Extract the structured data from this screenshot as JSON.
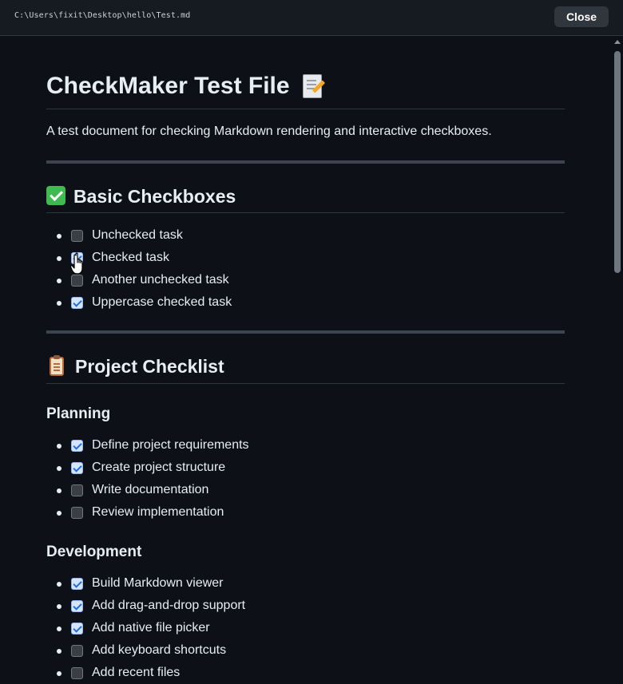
{
  "window": {
    "file_path": "C:\\Users\\fixit\\Desktop\\hello\\Test.md",
    "close_label": "Close"
  },
  "document": {
    "title": "CheckMaker Test File",
    "title_icon": "memo-icon",
    "description": "A test document for checking Markdown rendering and interactive checkboxes.",
    "sections": [
      {
        "heading": "Basic Checkboxes",
        "icon": "check-mark-button-icon",
        "tasks": [
          {
            "label": "Unchecked task",
            "checked": false
          },
          {
            "label": "Checked task",
            "checked": true
          },
          {
            "label": "Another unchecked task",
            "checked": false
          },
          {
            "label": "Uppercase checked task",
            "checked": true
          }
        ]
      },
      {
        "heading": "Project Checklist",
        "icon": "clipboard-icon",
        "subsections": [
          {
            "heading": "Planning",
            "tasks": [
              {
                "label": "Define project requirements",
                "checked": true
              },
              {
                "label": "Create project structure",
                "checked": true
              },
              {
                "label": "Write documentation",
                "checked": false
              },
              {
                "label": "Review implementation",
                "checked": false
              }
            ]
          },
          {
            "heading": "Development",
            "tasks": [
              {
                "label": "Build Markdown viewer",
                "checked": true
              },
              {
                "label": "Add drag-and-drop support",
                "checked": true
              },
              {
                "label": "Add native file picker",
                "checked": true
              },
              {
                "label": "Add keyboard shortcuts",
                "checked": false
              },
              {
                "label": "Add recent files",
                "checked": false
              }
            ]
          }
        ]
      }
    ]
  },
  "colors": {
    "background": "#0d1117",
    "titlebar": "#161b22",
    "text": "#e6edf3",
    "checkbox_checked": "#d6e4ff",
    "checkbox_unchecked": "#3b3f45"
  }
}
